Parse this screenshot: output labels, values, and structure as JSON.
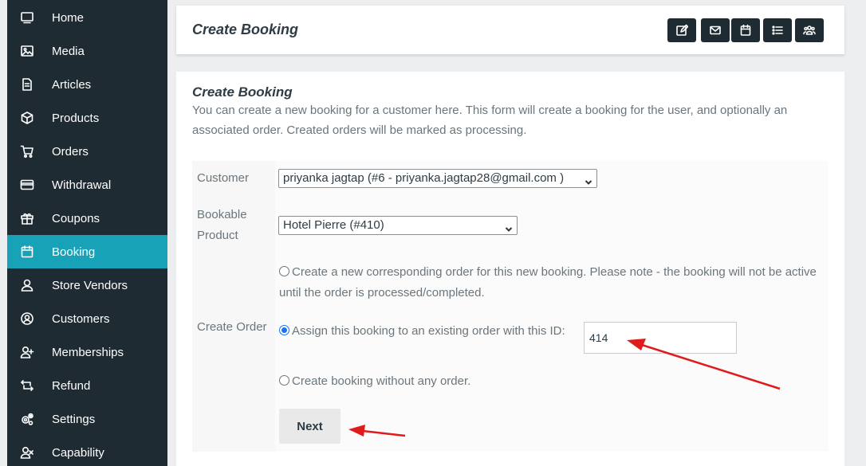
{
  "sidebar": {
    "items": [
      {
        "label": "Home",
        "icon": "monitor-icon",
        "active": false
      },
      {
        "label": "Media",
        "icon": "image-icon",
        "active": false
      },
      {
        "label": "Articles",
        "icon": "document-icon",
        "active": false
      },
      {
        "label": "Products",
        "icon": "box-icon",
        "active": false
      },
      {
        "label": "Orders",
        "icon": "cart-icon",
        "active": false
      },
      {
        "label": "Withdrawal",
        "icon": "credit-card-icon",
        "active": false
      },
      {
        "label": "Coupons",
        "icon": "gift-icon",
        "active": false
      },
      {
        "label": "Booking",
        "icon": "calendar-icon",
        "active": true
      },
      {
        "label": "Store Vendors",
        "icon": "user-icon",
        "active": false
      },
      {
        "label": "Customers",
        "icon": "user-circle-icon",
        "active": false
      },
      {
        "label": "Memberships",
        "icon": "user-plus-icon",
        "active": false
      },
      {
        "label": "Refund",
        "icon": "refund-icon",
        "active": false
      },
      {
        "label": "Settings",
        "icon": "gears-icon",
        "active": false
      },
      {
        "label": "Capability",
        "icon": "user-x-icon",
        "active": false
      }
    ]
  },
  "header": {
    "title": "Create Booking",
    "buttons": [
      "edit-icon",
      "envelope-icon",
      "calendar-icon",
      "list-icon",
      "users-icon"
    ]
  },
  "form": {
    "title": "Create Booking",
    "description": "You can create a new booking for a customer here. This form will create a booking for the user, and optionally an associated order. Created orders will be marked as processing.",
    "customer_label": "Customer",
    "customer_value": "priyanka jagtap (#6 - priyanka.jagtap28@gmail.com )",
    "product_label": "Bookable Product",
    "product_value": "Hotel Pierre (#410)",
    "order_label": "Create Order",
    "option_new": "Create a new corresponding order for this new booking. Please note - the booking will not be active until the order is processed/completed.",
    "option_existing": "Assign this booking to an existing order with this ID:",
    "existing_order_id": "414",
    "option_none": "Create booking without any order.",
    "next_label": "Next"
  },
  "colors": {
    "sidebar_bg": "#1f2b33",
    "active_bg": "#17a2b8",
    "annotation_arrow": "#e01b1b"
  }
}
